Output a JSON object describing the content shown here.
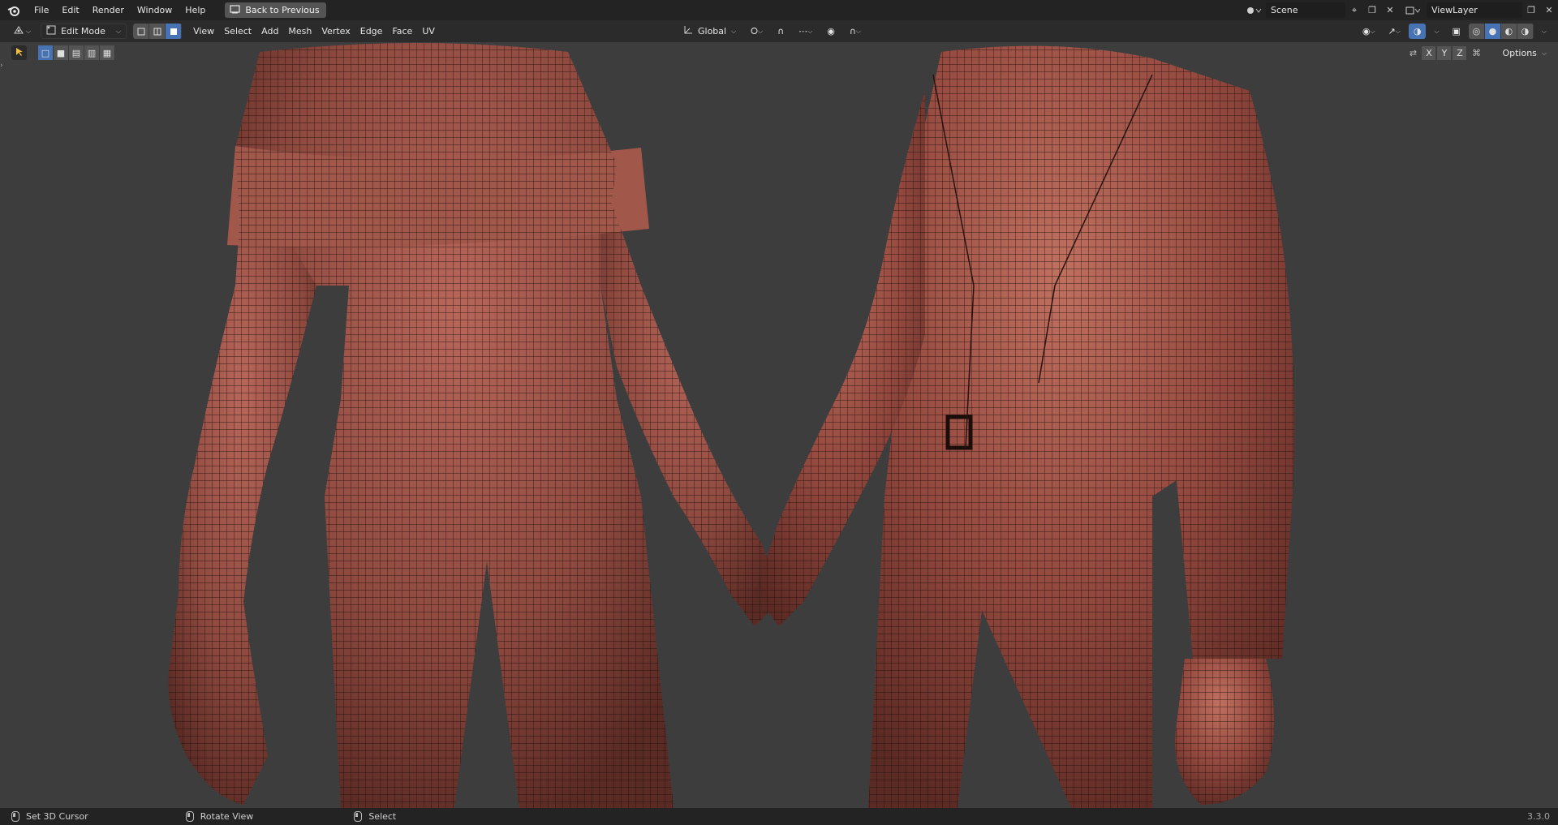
{
  "menubar": {
    "items": [
      "File",
      "Edit",
      "Render",
      "Window",
      "Help"
    ],
    "back_button": "Back to Previous",
    "scene_name": "Scene",
    "view_layer": "ViewLayer"
  },
  "header": {
    "mode": "Edit Mode",
    "menus": [
      "View",
      "Select",
      "Add",
      "Mesh",
      "Vertex",
      "Edge",
      "Face",
      "UV"
    ],
    "transform_orientation": "Global",
    "axes": [
      "X",
      "Y",
      "Z"
    ],
    "options_label": "Options"
  },
  "statusbar": {
    "left": "Set 3D Cursor",
    "middle": "Rotate View",
    "right": "Select",
    "version": "3.3.0"
  },
  "colors": {
    "mesh": "#8f4a40",
    "wire": "#1a0d0a",
    "accent": "#4772b3"
  }
}
